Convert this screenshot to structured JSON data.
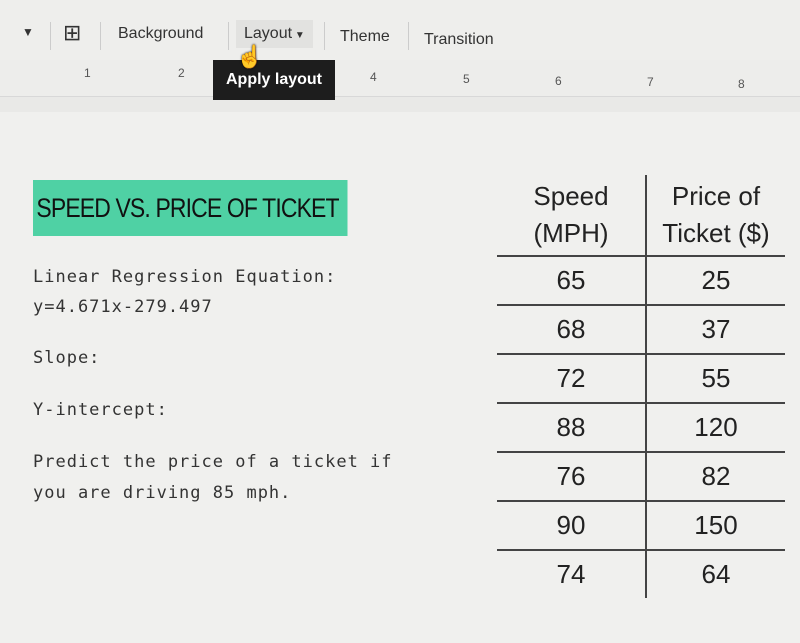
{
  "toolbar": {
    "background": "Background",
    "layout": "Layout",
    "theme": "Theme",
    "transition": "Transition",
    "tooltip": "Apply layout"
  },
  "ruler": [
    "1",
    "2",
    "4",
    "5",
    "6",
    "7",
    "8"
  ],
  "slide": {
    "title": "Speed vs. Price of Ticket",
    "equation_label": "Linear Regression Equation:",
    "equation": "y=4.671x-279.497",
    "slope": "Slope:",
    "intercept": "Y-intercept:",
    "predict_1": "Predict the price of a ticket if",
    "predict_2": "you are driving 85 mph.",
    "table": {
      "headers": [
        [
          "Speed",
          "(MPH)"
        ],
        [
          "Price of",
          "Ticket ($)"
        ]
      ],
      "rows": [
        [
          "65",
          "25"
        ],
        [
          "68",
          "37"
        ],
        [
          "72",
          "55"
        ],
        [
          "88",
          "120"
        ],
        [
          "76",
          "82"
        ],
        [
          "90",
          "150"
        ],
        [
          "74",
          "64"
        ]
      ]
    }
  },
  "colors": {
    "title_highlight": "#4fd1a4"
  }
}
